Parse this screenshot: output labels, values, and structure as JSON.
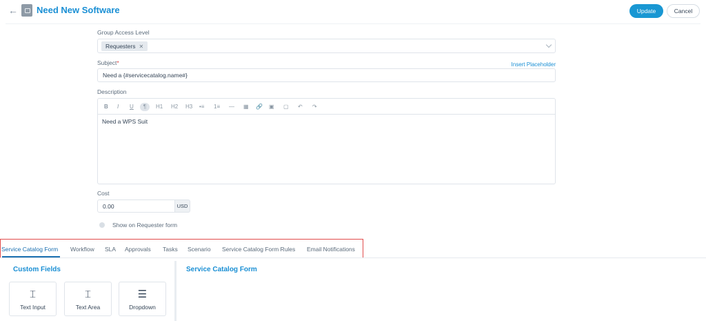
{
  "header": {
    "title": "Need New Software",
    "update_label": "Update",
    "cancel_label": "Cancel"
  },
  "form": {
    "group_access": {
      "label": "Group Access Level",
      "selected_tags": [
        "Requesters"
      ]
    },
    "subject": {
      "label": "Subject",
      "required_mark": "*",
      "insert_placeholder": "Insert Placeholder",
      "value": "Need a {#servicecatalog.name#}"
    },
    "description": {
      "label": "Description",
      "toolbar": [
        "B",
        "I",
        "U",
        "¶",
        "H1",
        "H2",
        "H3",
        "•≡",
        "1≡",
        "—",
        "▦",
        "🔗",
        "▣",
        "▢",
        "↶",
        "↷"
      ],
      "value": "Need a WPS Suit"
    },
    "cost": {
      "label": "Cost",
      "value": "0.00",
      "unit": "USD"
    },
    "show_on_requester": {
      "label": "Show on Requester form",
      "checked": false
    }
  },
  "tabs": [
    {
      "label": "Service Catalog Form",
      "active": true
    },
    {
      "label": "Workflow",
      "active": false
    },
    {
      "label": "SLA",
      "active": false
    },
    {
      "label": "Approvals",
      "active": false
    },
    {
      "label": "Tasks",
      "active": false
    },
    {
      "label": "Scenario",
      "active": false
    },
    {
      "label": "Service Catalog Form Rules",
      "active": false
    },
    {
      "label": "Email Notifications",
      "active": false
    }
  ],
  "custom_fields": {
    "title": "Custom Fields",
    "cards": [
      {
        "label": "Text Input",
        "icon": "text-cursor-icon"
      },
      {
        "label": "Text Area",
        "icon": "text-area-icon"
      },
      {
        "label": "Dropdown",
        "icon": "dropdown-list-icon"
      }
    ]
  },
  "catalog_form": {
    "title": "Service Catalog Form"
  },
  "colors": {
    "accent": "#1a8fd4",
    "primary_button": "#1997d3",
    "highlight_border": "#e14b4b"
  }
}
